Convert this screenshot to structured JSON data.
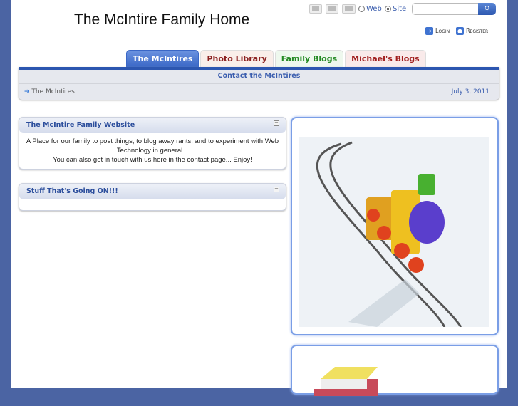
{
  "header": {
    "title": "The McIntire Family Home",
    "radio_web": "Web",
    "radio_site": "Site",
    "search_placeholder": "",
    "login": "Login",
    "register": "Register"
  },
  "tabs": [
    {
      "label": "The McIntires"
    },
    {
      "label": "Photo Library"
    },
    {
      "label": "Family Blogs"
    },
    {
      "label": "Michael's Blogs"
    }
  ],
  "subnav": {
    "contact": "Contact the McIntires",
    "breadcrumb": "The McIntires",
    "date": "July 3, 2011"
  },
  "boxes": [
    {
      "title": "The McIntire Family Website",
      "line1": "A Place for our family to post things, to blog away rants, and to experiment with Web Technology in general...",
      "line2": "You can also get in touch with us here in the contact page...   Enjoy!"
    },
    {
      "title": "Stuff That's Going ON!!!"
    }
  ]
}
